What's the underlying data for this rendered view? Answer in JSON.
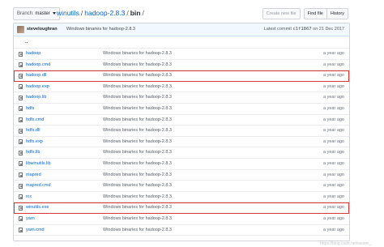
{
  "branch": {
    "prefix": "Branch:",
    "name": "master"
  },
  "breadcrumb": {
    "repo": "winutils",
    "dir1": "hadoop-2.8.3",
    "current": "bin",
    "separator": "/"
  },
  "actions": {
    "create": "Create new file",
    "find": "Find file",
    "history": "History"
  },
  "commit": {
    "author": "steveloughran",
    "message": "Windows binaries for hadoop-2.8.3",
    "latest_label": "Latest commit",
    "sha": "c1f1867",
    "date": "on 21 Dec 2017"
  },
  "up_link": "..",
  "files": [
    {
      "name": "hadoop",
      "message": "Windows binaries for hadoop-2.8.3",
      "age": "a year ago",
      "highlight": false
    },
    {
      "name": "hadoop.cmd",
      "message": "Windows binaries for hadoop-2.8.3",
      "age": "a year ago",
      "highlight": false
    },
    {
      "name": "hadoop.dll",
      "message": "Windows binaries for hadoop-2.8.3",
      "age": "a year ago",
      "highlight": true
    },
    {
      "name": "hadoop.exp",
      "message": "Windows binaries for hadoop-2.8.3",
      "age": "a year ago",
      "highlight": false
    },
    {
      "name": "hadoop.lib",
      "message": "Windows binaries for hadoop-2.8.3",
      "age": "a year ago",
      "highlight": false
    },
    {
      "name": "hdfs",
      "message": "Windows binaries for hadoop-2.8.3",
      "age": "a year ago",
      "highlight": false
    },
    {
      "name": "hdfs.cmd",
      "message": "Windows binaries for hadoop-2.8.3",
      "age": "a year ago",
      "highlight": false
    },
    {
      "name": "hdfs.dll",
      "message": "Windows binaries for hadoop-2.8.3",
      "age": "a year ago",
      "highlight": false
    },
    {
      "name": "hdfs.exp",
      "message": "Windows binaries for hadoop-2.8.3",
      "age": "a year ago",
      "highlight": false
    },
    {
      "name": "hdfs.lib",
      "message": "Windows binaries for hadoop-2.8.3",
      "age": "a year ago",
      "highlight": false
    },
    {
      "name": "libwinutils.lib",
      "message": "Windows binaries for hadoop-2.8.3",
      "age": "a year ago",
      "highlight": false
    },
    {
      "name": "mapred",
      "message": "Windows binaries for hadoop-2.8.3",
      "age": "a year ago",
      "highlight": false
    },
    {
      "name": "mapred.cmd",
      "message": "Windows binaries for hadoop-2.8.3",
      "age": "a year ago",
      "highlight": false
    },
    {
      "name": "rcc",
      "message": "Windows binaries for hadoop-2.8.3",
      "age": "a year ago",
      "highlight": false
    },
    {
      "name": "winutils.exe",
      "message": "Windows binaries for hadoop-2.8.3",
      "age": "a year ago",
      "highlight": true
    },
    {
      "name": "yarn",
      "message": "Windows binaries for hadoop-2.8.3",
      "age": "a year ago",
      "highlight": false
    },
    {
      "name": "yarn.cmd",
      "message": "Windows binaries for hadoop-2.8.3",
      "age": "a year ago",
      "highlight": false
    }
  ]
}
